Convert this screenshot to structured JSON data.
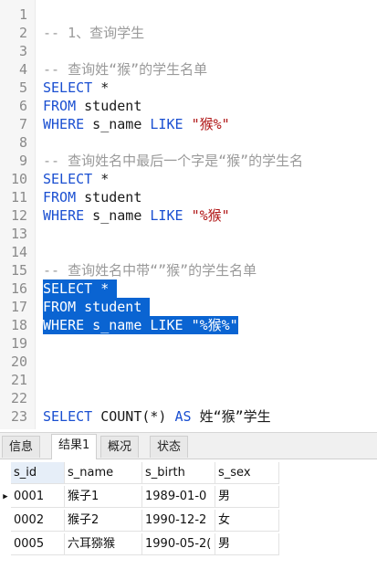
{
  "editor": {
    "lines": [
      {
        "n": "1",
        "parts": []
      },
      {
        "n": "2",
        "parts": [
          {
            "t": "-- 1、查询学生",
            "c": "cmt"
          }
        ]
      },
      {
        "n": "3",
        "parts": []
      },
      {
        "n": "4",
        "parts": [
          {
            "t": "-- 查询姓“猴”的学生名单",
            "c": "cmt"
          }
        ]
      },
      {
        "n": "5",
        "parts": [
          {
            "t": "SELECT",
            "c": "kw"
          },
          {
            "t": " *",
            "c": "plain"
          }
        ]
      },
      {
        "n": "6",
        "parts": [
          {
            "t": "FROM",
            "c": "kw"
          },
          {
            "t": " student",
            "c": "plain"
          }
        ]
      },
      {
        "n": "7",
        "parts": [
          {
            "t": "WHERE",
            "c": "kw"
          },
          {
            "t": " s_name ",
            "c": "plain"
          },
          {
            "t": "LIKE",
            "c": "kw"
          },
          {
            "t": " ",
            "c": "plain"
          },
          {
            "t": "\"猴%\"",
            "c": "str"
          }
        ]
      },
      {
        "n": "8",
        "parts": []
      },
      {
        "n": "9",
        "parts": [
          {
            "t": "-- 查询姓名中最后一个字是“猴”的学生名",
            "c": "cmt"
          }
        ]
      },
      {
        "n": "10",
        "parts": [
          {
            "t": "SELECT",
            "c": "kw"
          },
          {
            "t": " *",
            "c": "plain"
          }
        ]
      },
      {
        "n": "11",
        "parts": [
          {
            "t": "FROM",
            "c": "kw"
          },
          {
            "t": " student",
            "c": "plain"
          }
        ]
      },
      {
        "n": "12",
        "parts": [
          {
            "t": "WHERE",
            "c": "kw"
          },
          {
            "t": " s_name ",
            "c": "plain"
          },
          {
            "t": "LIKE",
            "c": "kw"
          },
          {
            "t": " ",
            "c": "plain"
          },
          {
            "t": "\"%猴\"",
            "c": "str"
          }
        ]
      },
      {
        "n": "13",
        "parts": []
      },
      {
        "n": "14",
        "parts": []
      },
      {
        "n": "15",
        "parts": [
          {
            "t": "-- 查询姓名中带“”猴”的学生名单",
            "c": "cmt"
          }
        ]
      },
      {
        "n": "16",
        "sel": true,
        "parts": [
          {
            "t": "SELECT",
            "c": "kw"
          },
          {
            "t": " * ",
            "c": "plain"
          }
        ]
      },
      {
        "n": "17",
        "sel": true,
        "parts": [
          {
            "t": "FROM",
            "c": "kw"
          },
          {
            "t": " student ",
            "c": "plain"
          }
        ]
      },
      {
        "n": "18",
        "sel": true,
        "parts": [
          {
            "t": "WHERE",
            "c": "kw"
          },
          {
            "t": " s_name ",
            "c": "plain"
          },
          {
            "t": "LIKE",
            "c": "kw"
          },
          {
            "t": " ",
            "c": "plain"
          },
          {
            "t": "\"%猴%\"",
            "c": "str"
          }
        ]
      },
      {
        "n": "19",
        "parts": []
      },
      {
        "n": "20",
        "parts": []
      },
      {
        "n": "21",
        "parts": []
      },
      {
        "n": "22",
        "parts": []
      },
      {
        "n": "23",
        "parts": [
          {
            "t": "SELECT",
            "c": "kw"
          },
          {
            "t": " COUNT(*) ",
            "c": "plain"
          },
          {
            "t": "AS",
            "c": "kw"
          },
          {
            "t": " 姓“猴”学生",
            "c": "plain"
          }
        ]
      }
    ]
  },
  "tabs": [
    "信息",
    "结果1",
    "概况",
    "状态"
  ],
  "active_tab": 1,
  "results": {
    "columns": [
      "s_id",
      "s_name",
      "s_birth",
      "s_sex"
    ],
    "rows": [
      [
        "0001",
        "猴子1",
        "1989-01-0",
        "男"
      ],
      [
        "0002",
        "猴子2",
        "1990-12-2",
        "女"
      ],
      [
        "0005",
        "六耳猕猴",
        "1990-05-2(",
        "男"
      ]
    ],
    "current_row_marker": "▶"
  }
}
